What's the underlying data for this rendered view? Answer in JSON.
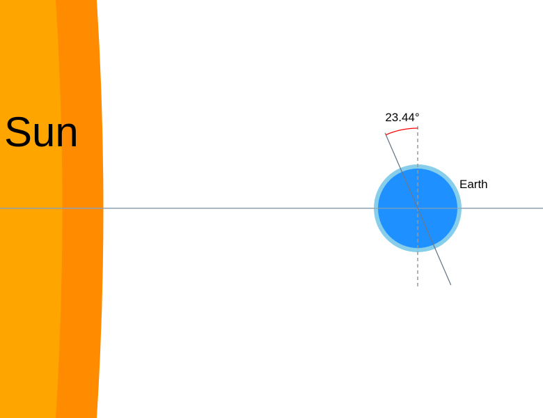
{
  "sun": {
    "label": "Sun",
    "inner_color": "#FFA500",
    "outer_color": "#FF8C00"
  },
  "earth": {
    "label": "Earth",
    "fill_color": "#1E90FF",
    "rim_color": "#87CEEB"
  },
  "tilt": {
    "angle_deg": 23.44,
    "label": "23.44°",
    "arc_color": "#FF0000"
  },
  "orbit_line_color": "#8FA0B0",
  "axis_color": "#6A7A8C",
  "vertical_reference_color": "#999999"
}
